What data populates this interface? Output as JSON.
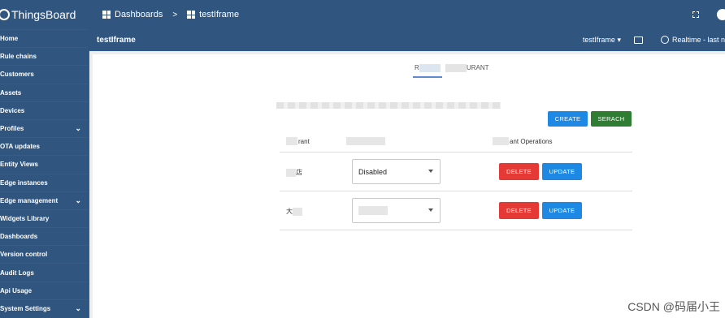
{
  "sidebar": {
    "brand": "ThingsBoard",
    "items": [
      {
        "label": "Home",
        "expandable": false
      },
      {
        "label": "Rule chains",
        "expandable": false
      },
      {
        "label": "Customers",
        "expandable": false
      },
      {
        "label": "Assets",
        "expandable": false
      },
      {
        "label": "Devices",
        "expandable": false
      },
      {
        "label": "Profiles",
        "expandable": true
      },
      {
        "label": "OTA updates",
        "expandable": false
      },
      {
        "label": "Entity Views",
        "expandable": false
      },
      {
        "label": "Edge instances",
        "expandable": false
      },
      {
        "label": "Edge management",
        "expandable": true
      },
      {
        "label": "Widgets Library",
        "expandable": false
      },
      {
        "label": "Dashboards",
        "expandable": false
      },
      {
        "label": "Version control",
        "expandable": false
      },
      {
        "label": "Audit Logs",
        "expandable": false
      },
      {
        "label": "Api Usage",
        "expandable": false
      },
      {
        "label": "System Settings",
        "expandable": true
      }
    ]
  },
  "header": {
    "breadcrumb_root": "Dashboards",
    "breadcrumb_sep": ">",
    "breadcrumb_current": "testIframe"
  },
  "subheader": {
    "title": "testIframe",
    "state_select": "testIframe",
    "state_caret": "▾",
    "realtime": "Realtime - last n"
  },
  "widget": {
    "tab_a_prefix": "R",
    "tab_b_suffix": "URANT",
    "buttons": {
      "create": "CREATE",
      "search": "SERACH"
    },
    "table": {
      "col1_suffix": "rant",
      "col3_suffix": "ant Operations",
      "rows": [
        {
          "name_prefix": "",
          "name_suffix": "店",
          "status": "Disabled",
          "delete": "DELETE",
          "update": "UPDATE"
        },
        {
          "name_prefix": "大",
          "name_suffix": "",
          "status": "",
          "delete": "DELETE",
          "update": "UPDATE"
        }
      ]
    }
  },
  "watermark": "CSDN @码届小王",
  "colors": {
    "header_bg": "#305680",
    "create": "#1e88e5",
    "search": "#2e7d32",
    "delete": "#e53935",
    "update": "#1e88e5"
  }
}
